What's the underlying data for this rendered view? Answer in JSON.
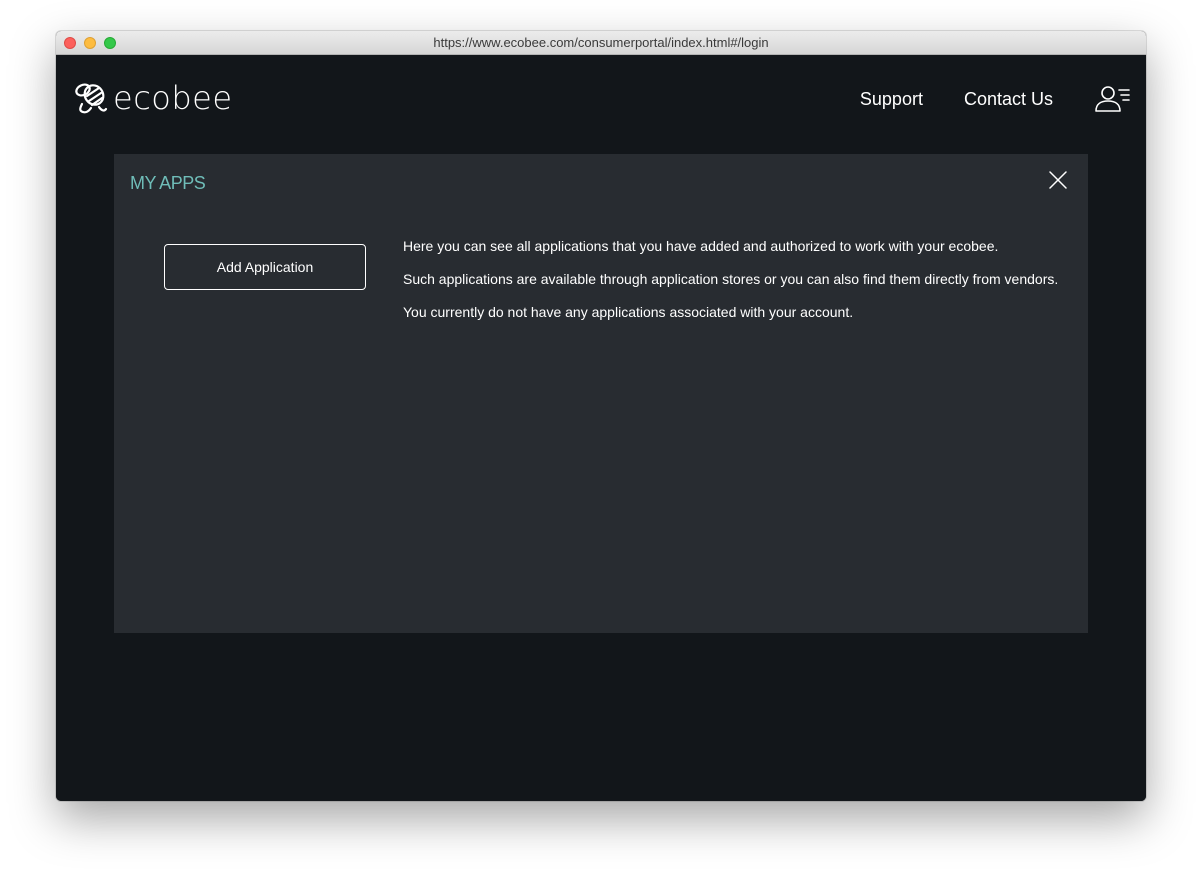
{
  "browser": {
    "url": "https://www.ecobee.com/consumerportal/index.html#/login"
  },
  "header": {
    "logo_text": "ecobee",
    "nav": {
      "support": "Support",
      "contact": "Contact Us"
    }
  },
  "panel": {
    "title": "MY APPS",
    "add_button_label": "Add Application",
    "description": [
      "Here you can see all applications that you have added and authorized to work with your ecobee.",
      "Such applications are available through application stores or you can also find them directly from vendors.",
      "You currently do not have any applications associated with your account."
    ]
  },
  "colors": {
    "page_bg": "#12161a",
    "panel_bg": "#282c31",
    "title_accent": "#6fbdb8"
  },
  "icons": {
    "logo": "bee-icon",
    "account": "account-menu-icon",
    "close": "close-icon"
  }
}
